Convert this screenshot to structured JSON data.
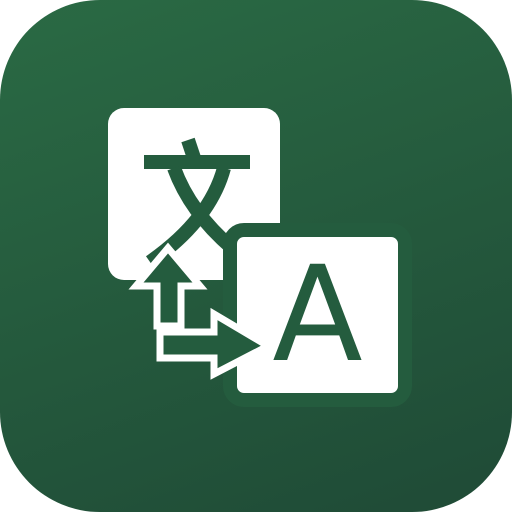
{
  "app_icon": {
    "icon": "translate-icon",
    "colors": {
      "background_top": "#2a6a44",
      "background_bottom": "#1f4a36",
      "card": "#ffffff",
      "glyph": "#245c3e"
    },
    "target_letter": "A"
  }
}
